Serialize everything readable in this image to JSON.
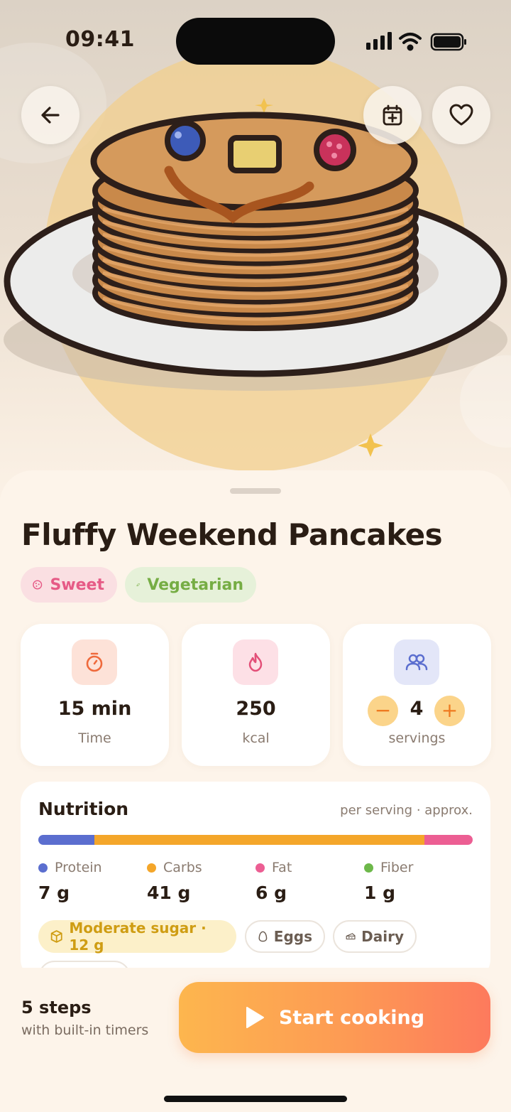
{
  "status_bar": {
    "time": "09:41"
  },
  "hero": {
    "icons": [
      "back-arrow-icon",
      "calendar-add-icon",
      "heart-icon"
    ],
    "illustration": "pancake-stack-illustration"
  },
  "recipe": {
    "title": "Fluffy Weekend Pancakes",
    "tags": [
      {
        "label": "Sweet",
        "icon": "cookie-icon",
        "color": "#e65a86"
      },
      {
        "label": "Vegetarian",
        "icon": "leaf-icon",
        "color": "#76ad44"
      }
    ]
  },
  "stats": {
    "time": {
      "value": "15 min",
      "label": "Time",
      "icon": "timer-icon"
    },
    "calories": {
      "value": "250",
      "label": "kcal",
      "icon": "flame-icon"
    },
    "servings": {
      "value": "4",
      "label": "servings",
      "icon": "people-icon",
      "decrement": "−",
      "increment": "+"
    }
  },
  "nutrition": {
    "title": "Nutrition",
    "note": "per serving · approx.",
    "macros": [
      {
        "name": "Protein",
        "value": "7 g",
        "grams": 7,
        "color": "#5b6ecf"
      },
      {
        "name": "Carbs",
        "value": "41 g",
        "grams": 41,
        "color": "#f4a62a"
      },
      {
        "name": "Fat",
        "value": "6 g",
        "grams": 6,
        "color": "#ec5e93"
      },
      {
        "name": "Fiber",
        "value": "1 g",
        "grams": 1,
        "color": "#6db84a"
      }
    ],
    "chips": [
      {
        "label": "Moderate sugar · 12 g",
        "icon": "box-icon"
      },
      {
        "label": "Eggs",
        "icon": "egg-icon"
      },
      {
        "label": "Dairy",
        "icon": "cheese-icon"
      }
    ]
  },
  "footer": {
    "steps": "5 steps",
    "steps_sub": "with built-in timers",
    "cta": "Start cooking"
  },
  "colors": {
    "accent_orange": "#fd9a54",
    "background": "#fdf4ea",
    "text": "#2a1d14"
  }
}
